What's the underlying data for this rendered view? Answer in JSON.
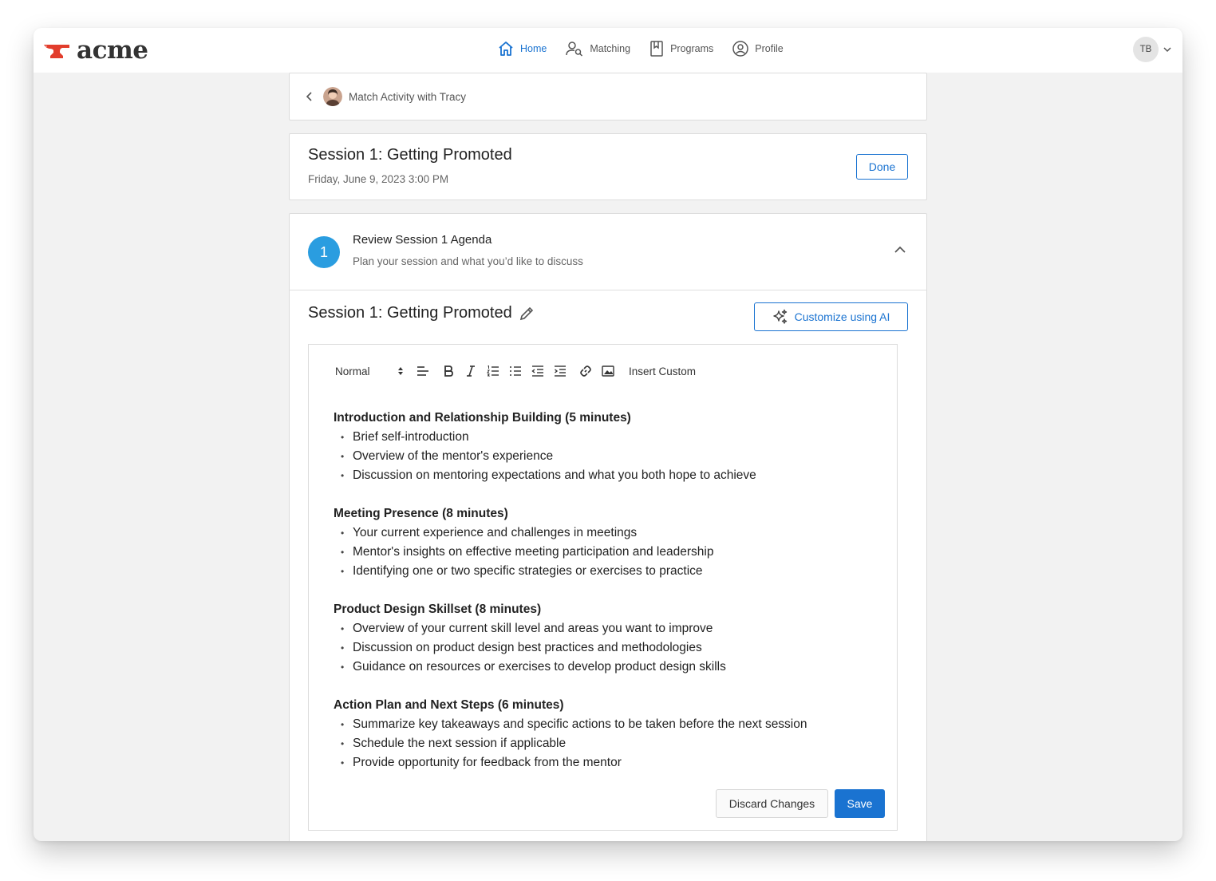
{
  "app": {
    "logo_text": "acme",
    "brand_color": "#1a73d1",
    "logo_color": "#e23d2c"
  },
  "nav": {
    "items": [
      {
        "label": "Home",
        "icon": "home-icon",
        "active": true
      },
      {
        "label": "Matching",
        "icon": "user-search-icon",
        "active": false
      },
      {
        "label": "Programs",
        "icon": "bookmark-icon",
        "active": false
      },
      {
        "label": "Profile",
        "icon": "user-circle-icon",
        "active": false
      }
    ]
  },
  "user": {
    "initials": "TB"
  },
  "breadcrumb": {
    "text": "Match Activity with Tracy"
  },
  "session": {
    "title": "Session 1: Getting Promoted",
    "datetime": "Friday, June 9, 2023 3:00 PM",
    "done_label": "Done"
  },
  "step": {
    "number": "1",
    "title": "Review Session 1 Agenda",
    "subtitle": "Plan your session and what you’d like to discuss"
  },
  "editor": {
    "title": "Session 1: Getting Promoted",
    "ai_button_label": "Customize using AI",
    "format_value": "Normal",
    "insert_custom_label": "Insert Custom",
    "sections": [
      {
        "heading": "Introduction and Relationship Building (5 minutes)",
        "items": [
          "Brief self-introduction",
          "Overview of the mentor's experience",
          "Discussion on mentoring expectations and what you both hope to achieve"
        ]
      },
      {
        "heading": "Meeting Presence (8 minutes)",
        "items": [
          "Your current experience and challenges in meetings",
          "Mentor's insights on effective meeting participation and leadership",
          "Identifying one or two specific strategies or exercises to practice"
        ]
      },
      {
        "heading": "Product Design Skillset (8 minutes)",
        "items": [
          "Overview of your current skill level and areas you want to improve",
          "Discussion on product design best practices and methodologies",
          "Guidance on resources or exercises to develop product design skills"
        ]
      },
      {
        "heading": "Action Plan and Next Steps (6 minutes)",
        "items": [
          "Summarize key takeaways and specific actions to be taken before the next session",
          "Schedule the next session if applicable",
          "Provide opportunity for feedback from the mentor"
        ]
      }
    ],
    "discard_label": "Discard Changes",
    "save_label": "Save"
  }
}
